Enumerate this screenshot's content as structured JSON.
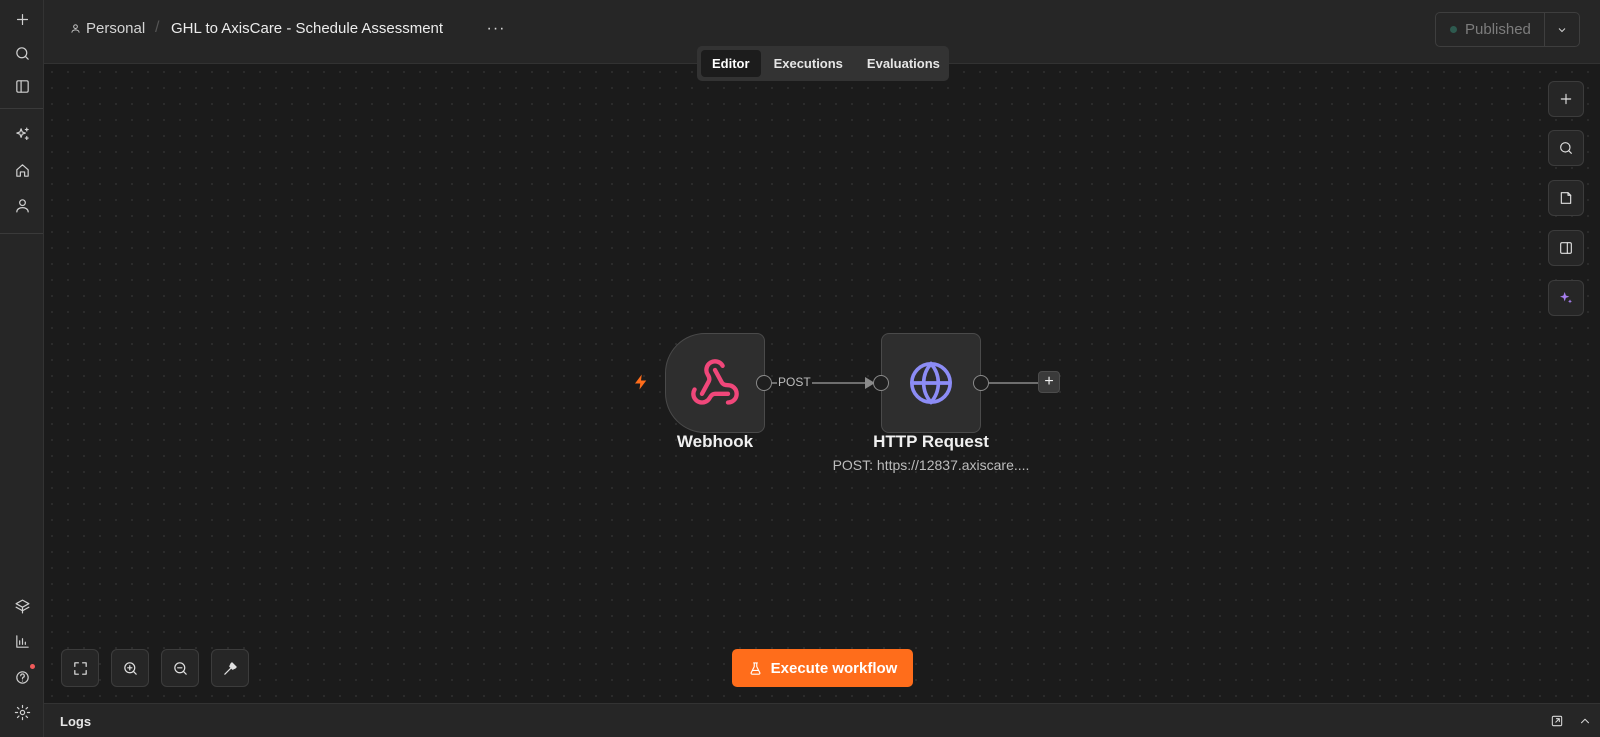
{
  "header": {
    "project": "Personal",
    "workflow_title": "GHL to AxisCare - Schedule Assessment",
    "more_label": "···",
    "publish_label": "Published"
  },
  "tabs": [
    {
      "label": "Editor",
      "active": true
    },
    {
      "label": "Executions",
      "active": false
    },
    {
      "label": "Evaluations",
      "active": false
    }
  ],
  "nodes": {
    "webhook": {
      "label": "Webhook",
      "icon": "webhook-icon",
      "color": "#f0477a"
    },
    "http": {
      "label": "HTTP Request",
      "subtitle": "POST: https://12837.axiscare....",
      "icon": "globe-icon",
      "color": "#8c8cf5"
    }
  },
  "edge": {
    "label": "POST"
  },
  "execute_button": {
    "label": "Execute workflow",
    "color": "#ff6d1b"
  },
  "logs": {
    "title": "Logs"
  },
  "sidebar": {
    "top": [
      "plus-icon",
      "search-icon",
      "panel-icon"
    ],
    "middle": [
      "sparkles-icon",
      "home-icon",
      "user-icon"
    ],
    "bottom": [
      "templates-icon",
      "insights-icon",
      "help-icon",
      "settings-icon"
    ]
  },
  "canvas_tools": [
    "add-node-icon",
    "search-icon",
    "sticky-note-icon",
    "side-panel-icon",
    "ai-assistant-icon"
  ],
  "zoom_tools": [
    "fit-view-icon",
    "zoom-in-icon",
    "zoom-out-icon",
    "tidy-up-icon"
  ]
}
